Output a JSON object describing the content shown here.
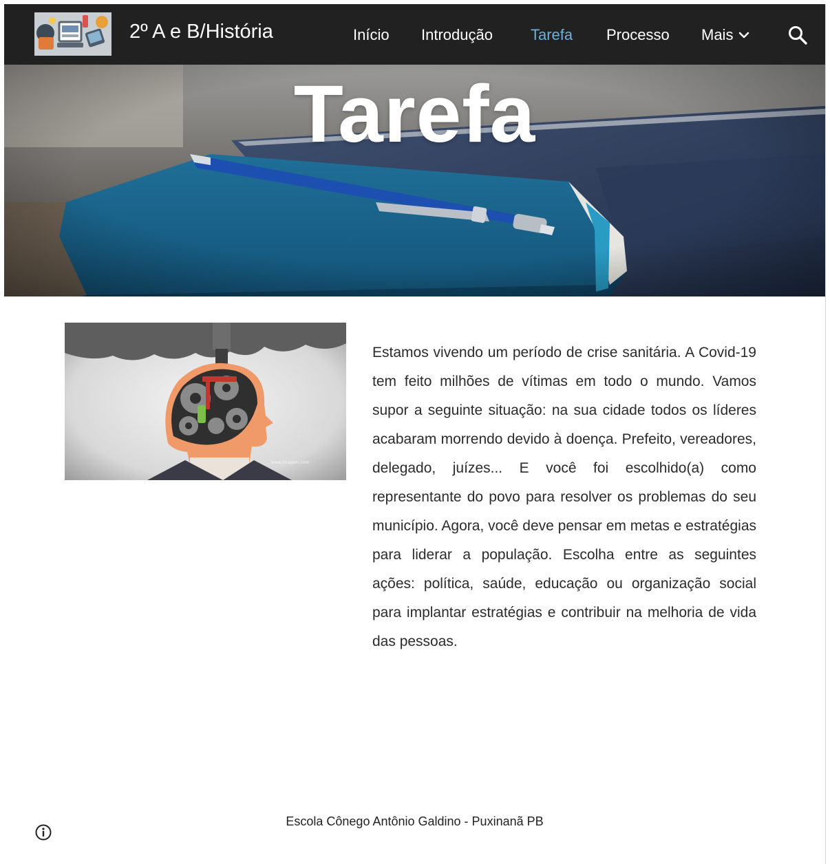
{
  "header": {
    "logo_icon": "site-logo-collage",
    "site_title": "2º A e B/História",
    "nav": [
      {
        "label": "Início",
        "active": false
      },
      {
        "label": "Introdução",
        "active": false
      },
      {
        "label": "Tarefa",
        "active": true
      },
      {
        "label": "Processo",
        "active": false
      },
      {
        "label": "Mais",
        "active": false,
        "has_dropdown": true
      }
    ],
    "search_icon": "search-icon",
    "colors": {
      "bar": "#212121",
      "active": "#6bb1d8",
      "text": "#ffffff"
    }
  },
  "hero": {
    "title": "Tarefa",
    "image": "blue-notebook-with-pen-photo"
  },
  "content": {
    "image": "head-with-gears-illustration",
    "paragraph": "Estamos vivendo um período de crise sanitária. A Covid-19 tem feito milhões de vítimas em todo o mundo. Vamos supor a seguinte situação: na sua cidade todos os líderes acabaram morrendo devido à doença. Prefeito, vereadores, delegado, juízes... E você foi escolhido(a) como representante do povo para resolver os problemas do seu município. Agora, você deve pensar em metas e estratégias para liderar a população. Escolha entre as seguintes ações: política, saúde, educação ou organização social para implantar estratégias e contribuir na melhoria de vida das pessoas."
  },
  "footer": {
    "text": "Escola Cônego Antônio Galdino - Puxinanã PB",
    "info_icon": "info-icon"
  }
}
